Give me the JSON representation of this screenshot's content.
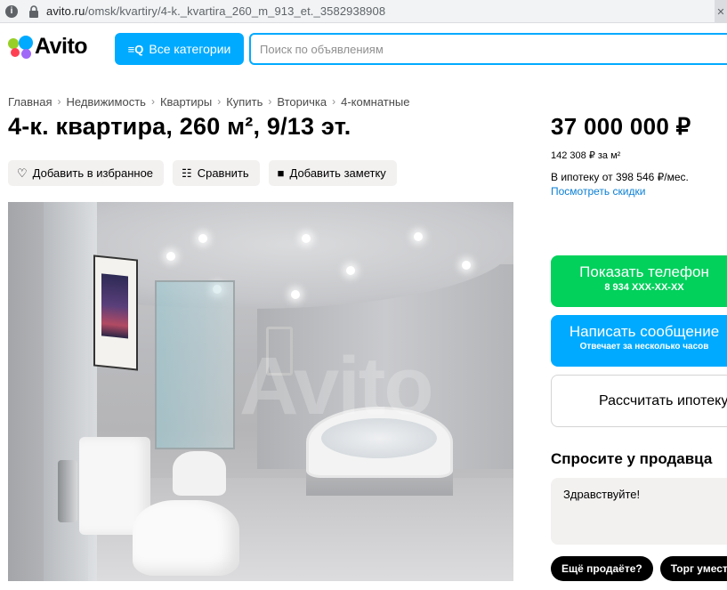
{
  "browser": {
    "url_domain": "avito.ru",
    "url_path": "/omsk/kvartiry/4-k._kvartira_260_m_913_et._3582938908"
  },
  "header": {
    "logo_text": "Avito",
    "categories_label": "Все категории",
    "search_placeholder": "Поиск по объявлениям"
  },
  "breadcrumbs": [
    "Главная",
    "Недвижимость",
    "Квартиры",
    "Купить",
    "Вторичка",
    "4-комнатные"
  ],
  "listing": {
    "title": "4-к. квартира, 260 м², 9/13 эт.",
    "actions": [
      {
        "icon": "heart-icon",
        "label": "Добавить в избранное"
      },
      {
        "icon": "compare-icon",
        "label": "Сравнить"
      },
      {
        "icon": "note-icon",
        "label": "Добавить заметку"
      }
    ],
    "photo_watermark": "Avito"
  },
  "sidebar": {
    "price": "37 000 000 ₽",
    "price_per_m": "142 308 ₽ за м²",
    "mortgage": "В ипотеку от 398 546 ₽/мес.",
    "discount_link": "Посмотреть скидки",
    "phone_button": {
      "label": "Показать телефон",
      "phone": "8 934 XXX-XX-XX"
    },
    "message_button": {
      "label": "Написать сообщение",
      "sub": "Отвечает за несколько часов"
    },
    "calc_button": "Рассчитать ипотеку",
    "ask_title": "Спросите у продавца",
    "ask_text": "Здравствуйте!",
    "chips": [
      "Ещё продаёте?",
      "Торг уместен?"
    ]
  },
  "colors": {
    "accent_blue": "#00aaff",
    "phone_green": "#02d15c",
    "link_blue": "#0a7fd6"
  }
}
